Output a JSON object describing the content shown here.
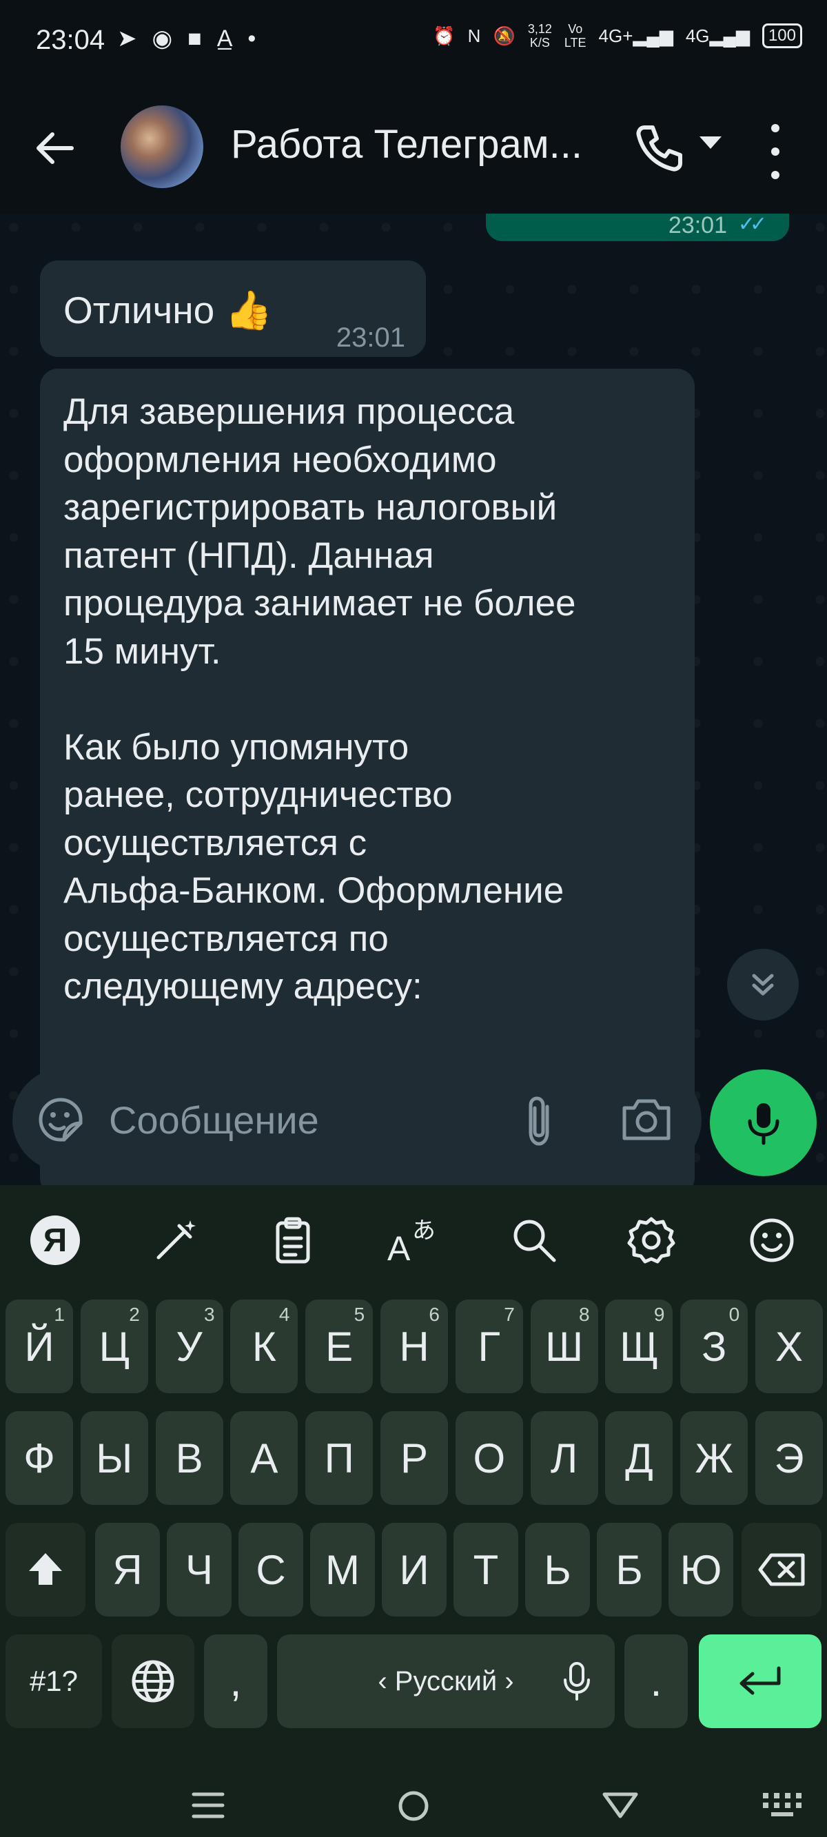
{
  "status_bar": {
    "time": "23:04",
    "network_speed_value": "3,12",
    "network_speed_unit": "K/S",
    "volte_top": "Vo",
    "volte_bottom": "LTE",
    "net1": "4G+",
    "net2": "4G",
    "battery": "100"
  },
  "header": {
    "title": "Работа Телеграм..."
  },
  "messages": {
    "previous_time": "23:01",
    "msg1_text": "Отлично 👍",
    "msg1_time": "23:01",
    "msg2_text": "Для завершения процесса\nоформления необходимо\nзарегистрировать налоговый\nпатент (НПД). Данная\nпроцедура занимает не более\n15 минут.\n\nКак было упомянуто\nранее, сотрудничество\nосуществляется с\nАльфа-Банком. Оформление\nосуществляется по\nследующему адресу:"
  },
  "input": {
    "placeholder": "Сообщение"
  },
  "keyboard": {
    "row1": [
      {
        "label": "Й",
        "hint": "1"
      },
      {
        "label": "Ц",
        "hint": "2"
      },
      {
        "label": "У",
        "hint": "3"
      },
      {
        "label": "К",
        "hint": "4"
      },
      {
        "label": "Е",
        "hint": "5"
      },
      {
        "label": "Н",
        "hint": "6"
      },
      {
        "label": "Г",
        "hint": "7"
      },
      {
        "label": "Ш",
        "hint": "8"
      },
      {
        "label": "Щ",
        "hint": "9"
      },
      {
        "label": "З",
        "hint": "0"
      },
      {
        "label": "Х",
        "hint": ""
      }
    ],
    "row2": [
      "Ф",
      "Ы",
      "В",
      "А",
      "П",
      "Р",
      "О",
      "Л",
      "Д",
      "Ж",
      "Э"
    ],
    "row3": [
      "Я",
      "Ч",
      "С",
      "М",
      "И",
      "Т",
      "Ь",
      "Б",
      "Ю"
    ],
    "symbols_label": "#1?",
    "comma_label": ",",
    "language_label": "‹ Русский ›",
    "period_label": "."
  },
  "colors": {
    "accent_green": "#21c063",
    "outgoing_bubble": "#005c4b",
    "incoming_bubble": "#1f2c34",
    "enter_key": "#5af09a"
  }
}
